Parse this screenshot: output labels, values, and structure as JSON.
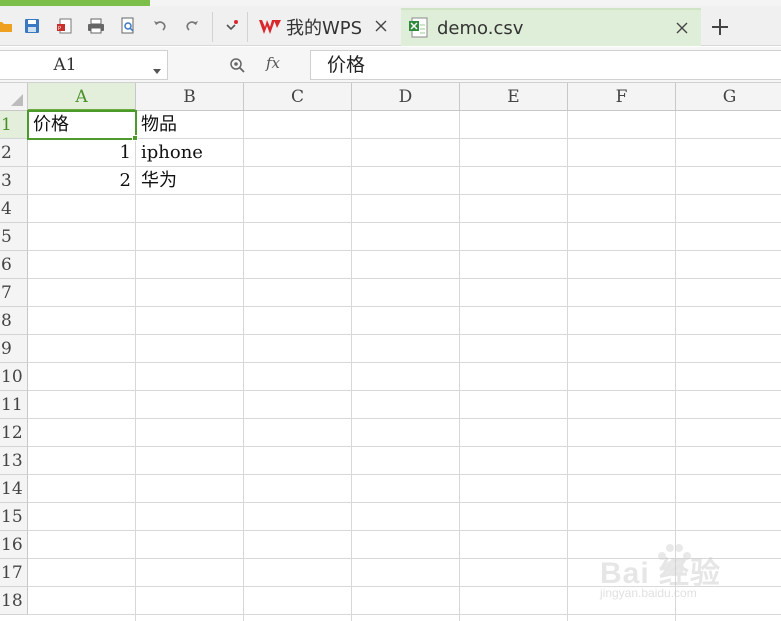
{
  "tabs": [
    {
      "label": "我的WPS",
      "icon": "wps-logo-icon",
      "active": false
    },
    {
      "label": "demo.csv",
      "icon": "spreadsheet-file-icon",
      "active": true
    }
  ],
  "formula_bar": {
    "name_box": "A1",
    "fx_label": "fx",
    "formula_value": "价格"
  },
  "sheet": {
    "columns": [
      "A",
      "B",
      "C",
      "D",
      "E",
      "F",
      "G"
    ],
    "rows": [
      "1",
      "2",
      "3",
      "4",
      "5",
      "6",
      "7",
      "8",
      "9",
      "10",
      "11",
      "12",
      "13",
      "14",
      "15",
      "16",
      "17",
      "18"
    ],
    "cells": {
      "A1": "价格",
      "B1": "物品",
      "A2": "1",
      "B2": "iphone",
      "A3": "2",
      "B3": "华为"
    },
    "selected_cell": "A1"
  },
  "watermark": {
    "brand": "Bai  经验",
    "url": "jingyan.baidu.com"
  },
  "colors": {
    "accent_green": "#7bbf4a",
    "selection_green": "#4c9a2a",
    "active_tab_bg": "#dfeed9",
    "wps_red": "#d9282c"
  }
}
